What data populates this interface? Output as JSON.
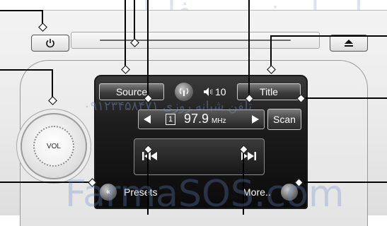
{
  "watermark": {
    "top_text": "امداد خودرو فارابی",
    "phone_text": "تلفن شبانه روزی ۰۹۱۲۳۴۵۸۴۷۱",
    "site_text": "FarmaSOS.com"
  },
  "hardware": {
    "power_icon": "power-icon",
    "eject_icon": "eject-icon",
    "vol_label": "VOL"
  },
  "screen": {
    "source_label": "Source",
    "title_label": "Title",
    "volume_level": "10",
    "preset_number": "1",
    "frequency": "97.9",
    "frequency_unit": "MHz",
    "scan_label": "Scan",
    "presets_label": "Presets",
    "more_label": "More.."
  },
  "icons": {
    "tune_down": "triangle-left-icon",
    "tune_up": "triangle-right-icon",
    "seek_back": "skip-back-icon",
    "seek_forward": "skip-forward-icon",
    "speaker": "speaker-icon",
    "signal": "signal-icon",
    "antenna": "antenna-icon"
  }
}
